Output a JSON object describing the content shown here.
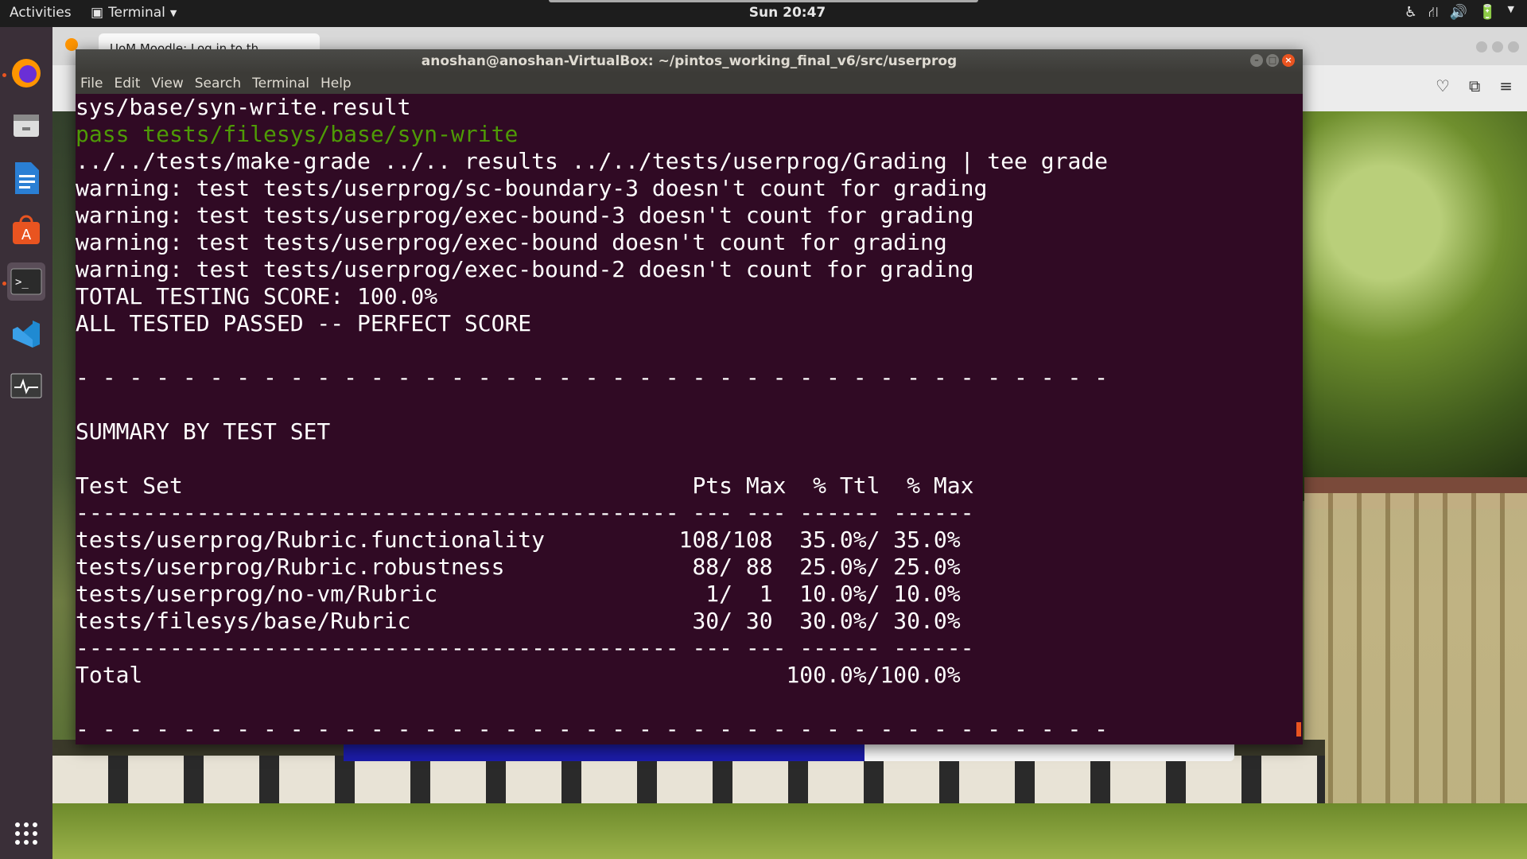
{
  "topbar": {
    "activities": "Activities",
    "app_name": "Terminal",
    "clock": "Sun 20:47"
  },
  "browser": {
    "tab_title": "UoM Moodle: Log in to th"
  },
  "terminal": {
    "title": "anoshan@anoshan-VirtualBox: ~/pintos_working_final_v6/src/userprog",
    "menu": [
      "File",
      "Edit",
      "View",
      "Search",
      "Terminal",
      "Help"
    ],
    "lines": [
      {
        "text": "sys/base/syn-write.result",
        "style": "normal"
      },
      {
        "text": "pass tests/filesys/base/syn-write",
        "style": "green"
      },
      {
        "text": "../../tests/make-grade ../.. results ../../tests/userprog/Grading | tee grade",
        "style": "normal"
      },
      {
        "text": "warning: test tests/userprog/sc-boundary-3 doesn't count for grading",
        "style": "normal"
      },
      {
        "text": "warning: test tests/userprog/exec-bound-3 doesn't count for grading",
        "style": "normal"
      },
      {
        "text": "warning: test tests/userprog/exec-bound doesn't count for grading",
        "style": "normal"
      },
      {
        "text": "warning: test tests/userprog/exec-bound-2 doesn't count for grading",
        "style": "normal"
      },
      {
        "text": "TOTAL TESTING SCORE: 100.0%",
        "style": "normal"
      },
      {
        "text": "ALL TESTED PASSED -- PERFECT SCORE",
        "style": "normal"
      },
      {
        "text": "",
        "style": "normal"
      },
      {
        "text": "- - - - - - - - - - - - - - - - - - - - - - - - - - - - - - - - - - - - - - -",
        "style": "normal"
      },
      {
        "text": "",
        "style": "normal"
      },
      {
        "text": "SUMMARY BY TEST SET",
        "style": "normal"
      },
      {
        "text": "",
        "style": "normal"
      },
      {
        "text": "Test Set                                      Pts Max  % Ttl  % Max",
        "style": "normal"
      },
      {
        "text": "--------------------------------------------- --- --- ------ ------",
        "style": "normal"
      },
      {
        "text": "tests/userprog/Rubric.functionality          108/108  35.0%/ 35.0%",
        "style": "normal"
      },
      {
        "text": "tests/userprog/Rubric.robustness              88/ 88  25.0%/ 25.0%",
        "style": "normal"
      },
      {
        "text": "tests/userprog/no-vm/Rubric                    1/  1  10.0%/ 10.0%",
        "style": "normal"
      },
      {
        "text": "tests/filesys/base/Rubric                     30/ 30  30.0%/ 30.0%",
        "style": "normal"
      },
      {
        "text": "--------------------------------------------- --- --- ------ ------",
        "style": "normal"
      },
      {
        "text": "Total                                                100.0%/100.0%",
        "style": "normal"
      },
      {
        "text": "",
        "style": "normal"
      },
      {
        "text": "- - - - - - - - - - - - - - - - - - - - - - - - - - - - - - - - - - - - - - -",
        "style": "normal"
      }
    ]
  },
  "dock": [
    {
      "name": "firefox-icon",
      "glyph": "🦊"
    },
    {
      "name": "files-icon",
      "glyph": "🗄"
    },
    {
      "name": "writer-icon",
      "glyph": "📄"
    },
    {
      "name": "software-icon",
      "glyph": "🅰"
    },
    {
      "name": "terminal-icon",
      "glyph": ">_"
    },
    {
      "name": "vscode-icon",
      "glyph": "⟨⟩"
    },
    {
      "name": "system-monitor-icon",
      "glyph": "📈"
    },
    {
      "name": "show-apps-icon",
      "glyph": "⋮⋮⋮"
    }
  ],
  "colors": {
    "terminal_bg": "#300a24",
    "terminal_green": "#4e9a06",
    "accent": "#e95420"
  }
}
